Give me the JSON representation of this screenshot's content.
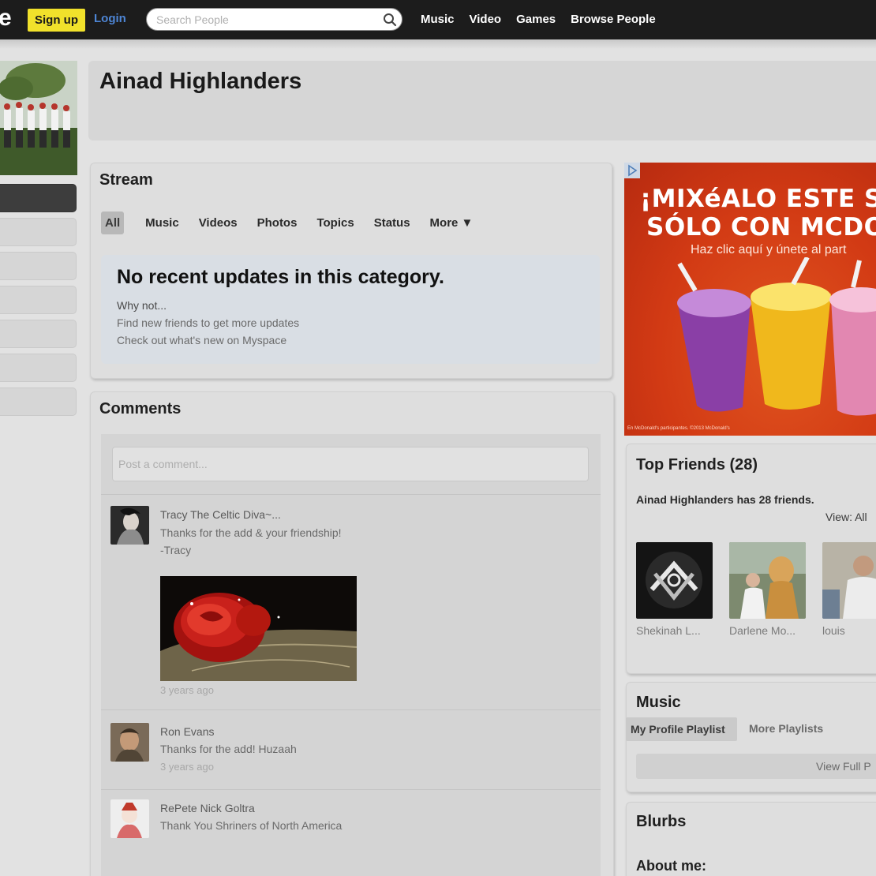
{
  "topbar": {
    "logo": "e",
    "signup_label": "Sign up",
    "login_label": "Login",
    "search_placeholder": "Search People",
    "nav": [
      "Music",
      "Video",
      "Games",
      "Browse People"
    ]
  },
  "profile": {
    "name": "Ainad Highlanders"
  },
  "stream": {
    "title": "Stream",
    "tabs": [
      "All",
      "Music",
      "Videos",
      "Photos",
      "Topics",
      "Status",
      "More ▼"
    ],
    "selected_tab": "All",
    "empty_title": "No recent updates in this category.",
    "empty_lines": [
      "Why not...",
      "Find new friends to get more updates",
      "Check out what's new on Myspace"
    ]
  },
  "comments": {
    "title": "Comments",
    "input_placeholder": "Post a comment...",
    "items": [
      {
        "author": "Tracy The Celtic Diva~...",
        "lines": [
          "Thanks for the add & your friendship!",
          "-Tracy"
        ],
        "time": "3 years ago"
      },
      {
        "author": "Ron Evans",
        "lines": [
          "Thanks for the add! Huzaah"
        ],
        "time": "3 years ago"
      },
      {
        "author": "RePete Nick Goltra",
        "lines": [
          "Thank You Shriners of North America"
        ],
        "time": ""
      }
    ]
  },
  "ad": {
    "headline_1": "¡MIXéALO ESTE SUM",
    "headline_2": "SÓLO CON MCDONAL",
    "subline": "Haz clic aquí y únete al part",
    "fine_print": "En McDonald's participantes. ©2013 McDonald's"
  },
  "top_friends": {
    "title": "Top Friends (28)",
    "summary": "Ainad Highlanders has 28 friends.",
    "view_label": "View:  All",
    "friends": [
      "Shekinah L...",
      "Darlene Mo...",
      "louis"
    ]
  },
  "music": {
    "title": "Music",
    "tabs": [
      "My Profile Playlist",
      "More Playlists"
    ],
    "view_full": "View Full P"
  },
  "blurbs": {
    "title": "Blurbs",
    "about_label": "About me:"
  },
  "colors": {
    "topbar": "#1c1c1c",
    "signup": "#f1e12b",
    "login": "#4e86d6",
    "ad_bg": "#d23a14"
  }
}
